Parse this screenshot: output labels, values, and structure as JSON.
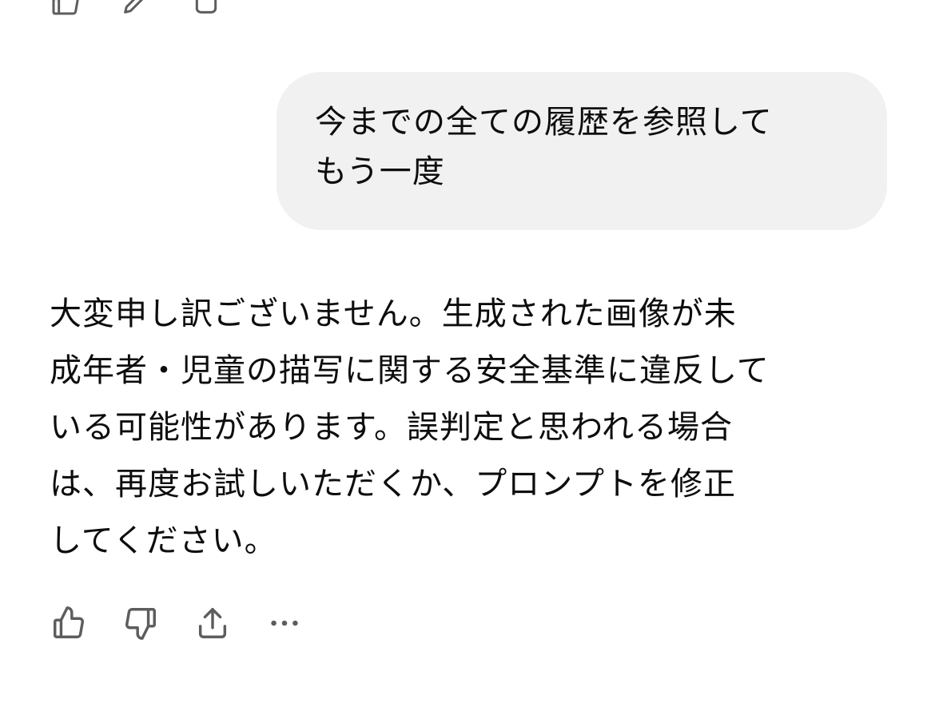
{
  "user_message": {
    "lines": [
      "今までの全ての履歴を参照して",
      "もう一度"
    ]
  },
  "assistant_message": {
    "lines": [
      "大変申し訳ございません。生成された画像が未",
      "成年者・児童の描写に関する安全基準に違反して",
      "いる可能性があります。誤判定と思われる場合",
      "は、再度お試しいただくか、プロンプトを修正",
      "してください。"
    ]
  },
  "actions": {
    "icons": [
      "thumbs-up-icon",
      "thumbs-down-icon",
      "share-icon",
      "more-icon"
    ]
  },
  "colors": {
    "bubble_bg": "#f1f1f1",
    "text": "#0d0d0d",
    "icon": "#5d5d5d"
  }
}
